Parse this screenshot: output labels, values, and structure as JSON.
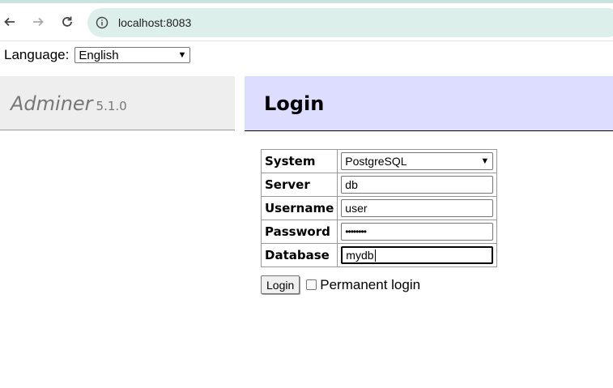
{
  "browser": {
    "url": "localhost:8083"
  },
  "language": {
    "label": "Language:",
    "selected": "English"
  },
  "menu": {
    "app_name": "Adminer",
    "version": "5.1.0"
  },
  "content": {
    "title": "Login"
  },
  "form": {
    "rows": [
      {
        "label": "System",
        "value": "PostgreSQL"
      },
      {
        "label": "Server",
        "value": "db"
      },
      {
        "label": "Username",
        "value": "user"
      },
      {
        "label": "Password",
        "value": "••••••••"
      },
      {
        "label": "Database",
        "value": "mydb"
      }
    ],
    "submit_label": "Login",
    "permanent_label": "Permanent login"
  }
}
